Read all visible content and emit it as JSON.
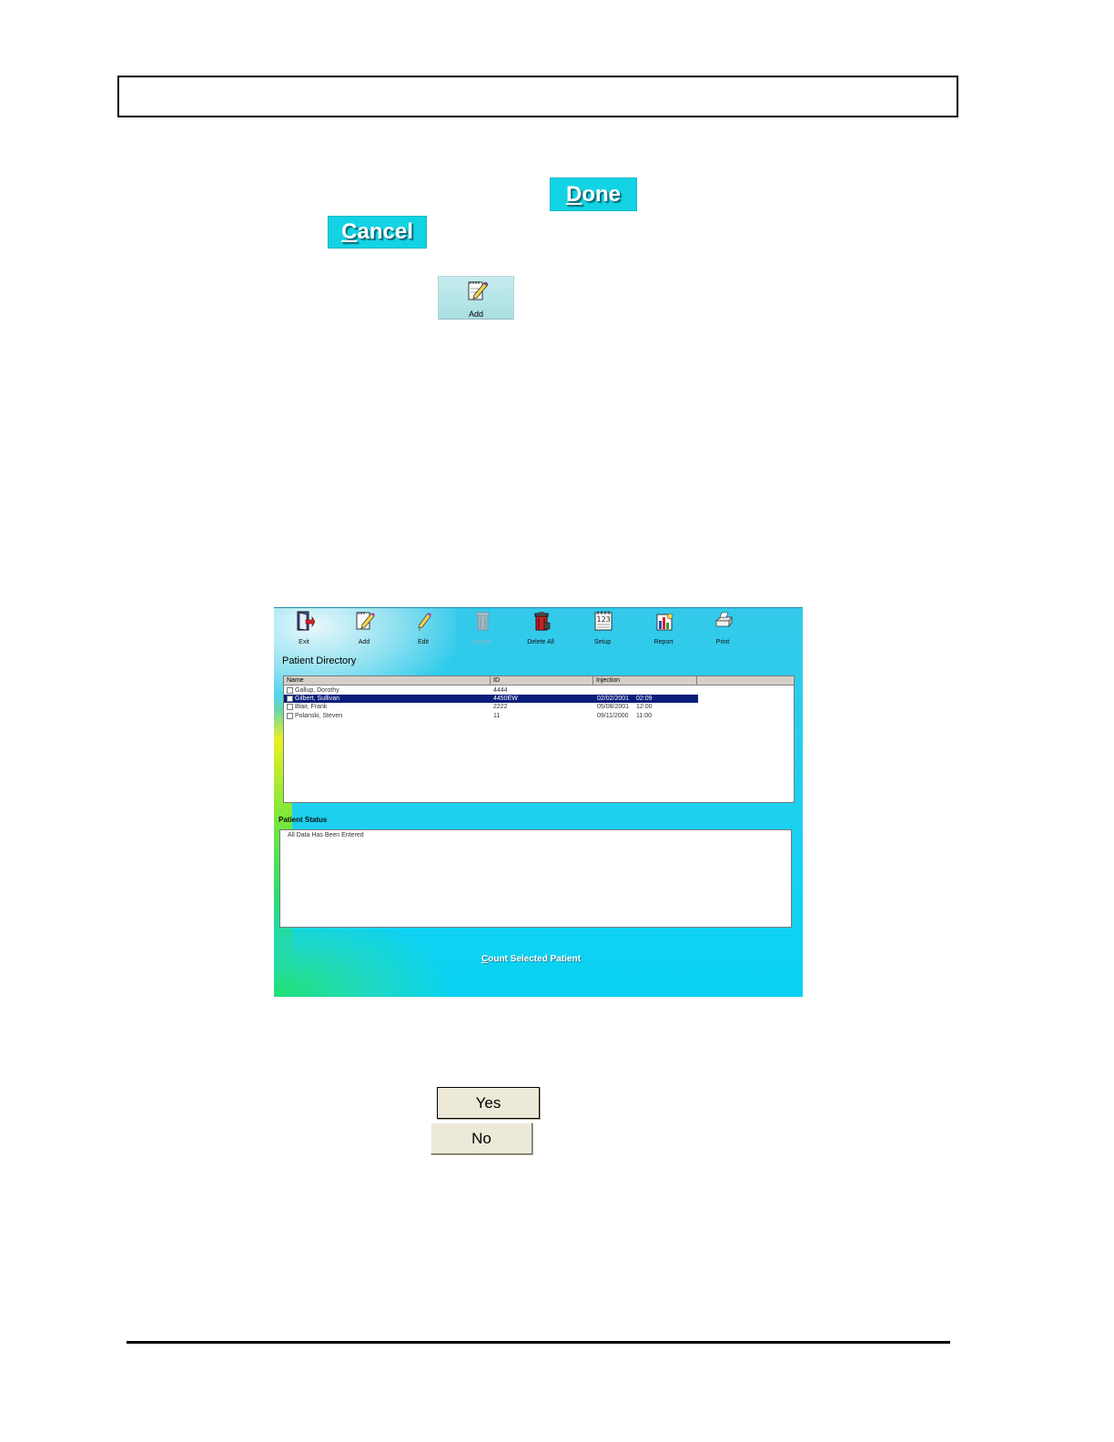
{
  "buttons": {
    "done": {
      "pre": "",
      "key": "D",
      "post": "one"
    },
    "cancel": {
      "pre": "",
      "key": "C",
      "post": "ancel"
    },
    "add_tool_label": "Add",
    "yes": "Yes",
    "no": "No"
  },
  "app": {
    "toolbar": [
      {
        "label": "Exit",
        "icon": "exit-door-icon"
      },
      {
        "label": "Add",
        "icon": "notepad-pencil-icon"
      },
      {
        "label": "Edit",
        "icon": "pencil-icon"
      },
      {
        "label": "Delete",
        "icon": "trash-can-icon",
        "disabled": true
      },
      {
        "label": "Delete All",
        "icon": "trash-can-red-icon"
      },
      {
        "label": "Setup",
        "icon": "calendar-123-icon"
      },
      {
        "label": "Report",
        "icon": "bar-chart-icon"
      },
      {
        "label": "Print",
        "icon": "printer-icon"
      }
    ],
    "directory_title": "Patient Directory",
    "columns": [
      "Name",
      "ID",
      "Injection"
    ],
    "patients": [
      {
        "name": "Gallup, Dorothy",
        "id": "4444",
        "date": "",
        "time": "",
        "selected": false
      },
      {
        "name": "Gilbert, Sullivan",
        "id": "4450EW",
        "date": "02/02/2001",
        "time": "02:09",
        "selected": true
      },
      {
        "name": "Blair, Frank",
        "id": "2222",
        "date": "05/08/2001",
        "time": "12:00",
        "selected": false
      },
      {
        "name": "Polanski, Steven",
        "id": "11",
        "date": "09/11/2000",
        "time": "11:00",
        "selected": false
      }
    ],
    "status_title": "Patient Status",
    "status_text": "All Data Has Been Entered",
    "count_button": {
      "key": "C",
      "rest": "ount Selected Patient"
    }
  }
}
